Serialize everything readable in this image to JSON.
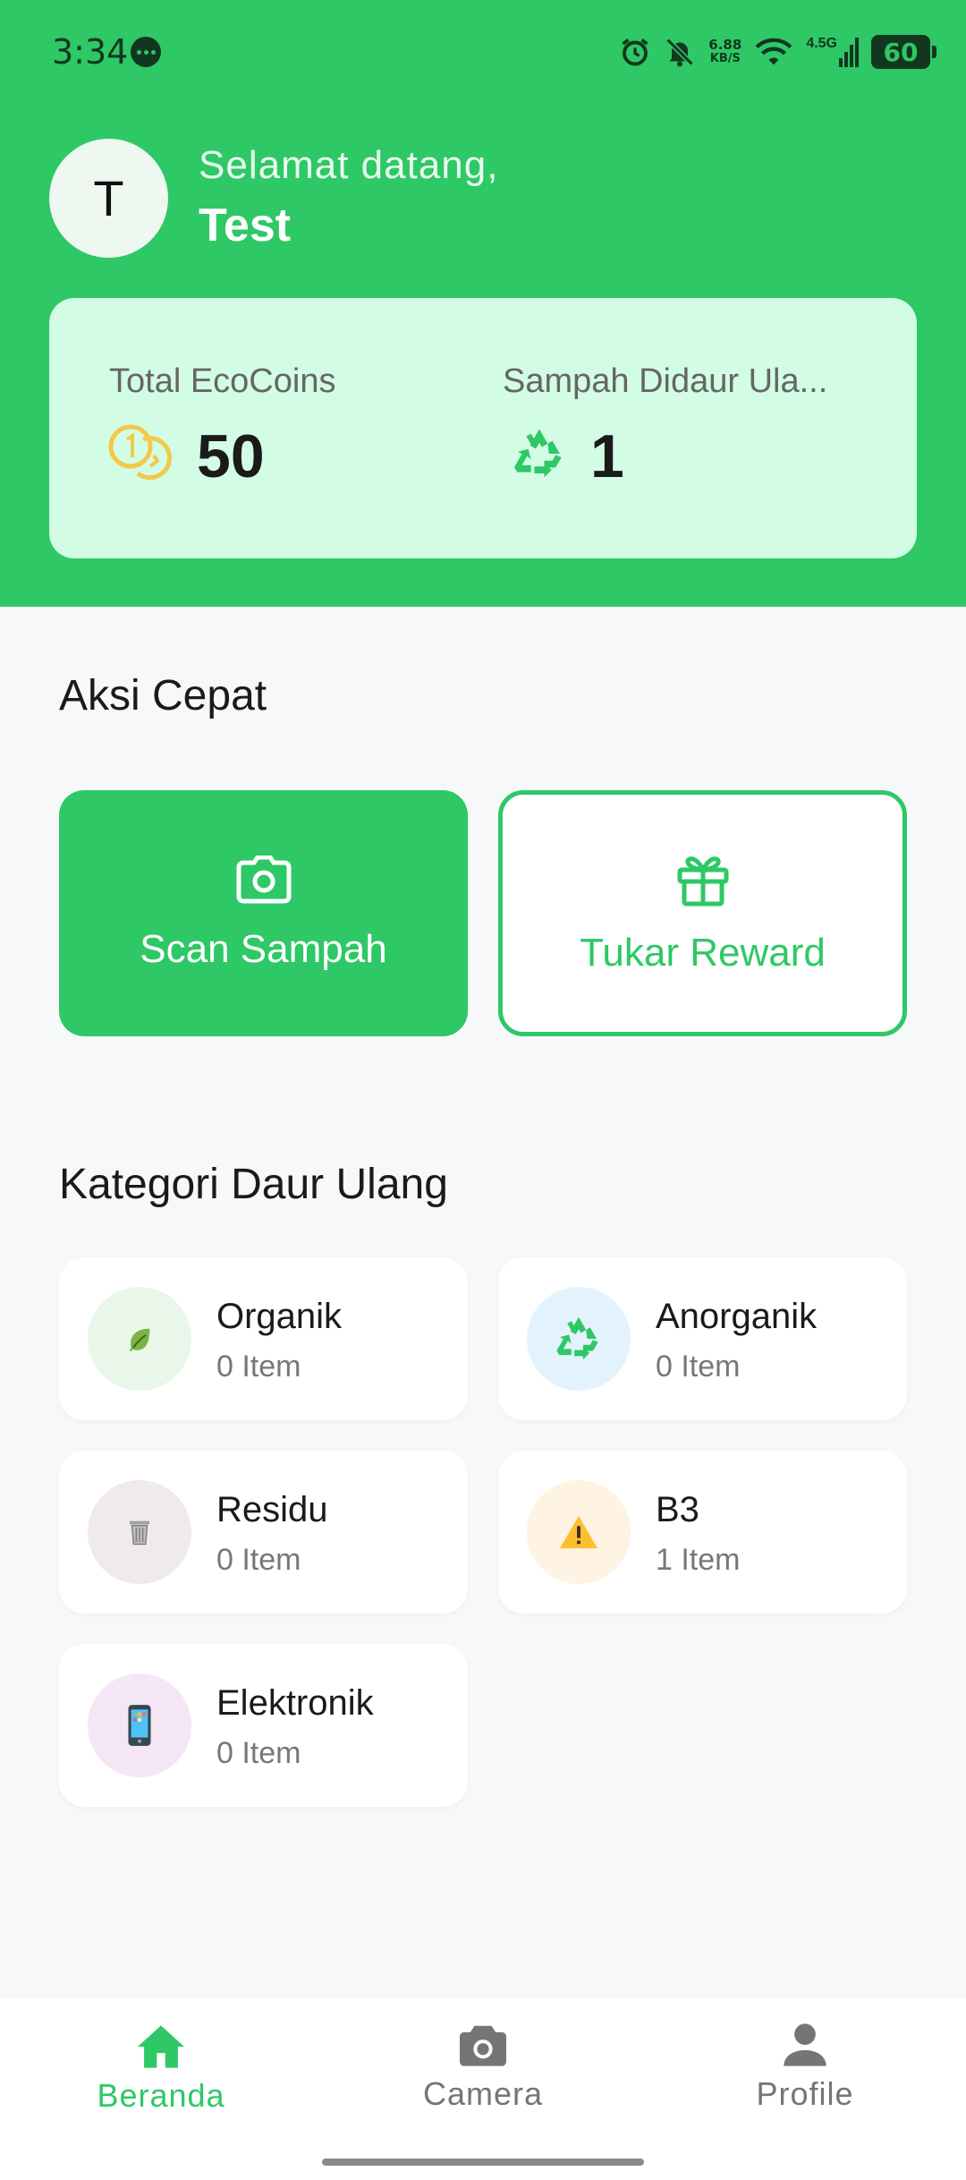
{
  "status_bar": {
    "time": "3:34",
    "speed_value": "6.88",
    "speed_unit": "KB/S",
    "network": "4.5G",
    "battery": "60"
  },
  "header": {
    "avatar_letter": "T",
    "greeting": "Selamat datang,",
    "username": "Test"
  },
  "stats": {
    "coins_label": "Total EcoCoins",
    "coins_value": "50",
    "recycled_label": "Sampah Didaur Ula...",
    "recycled_value": "1"
  },
  "quick_actions": {
    "title": "Aksi Cepat",
    "scan_label": "Scan Sampah",
    "reward_label": "Tukar Reward"
  },
  "categories": {
    "title": "Kategori Daur Ulang",
    "items": [
      {
        "name": "Organik",
        "count": "0 Item",
        "icon": "leaf-icon",
        "color": "#e9f6ea"
      },
      {
        "name": "Anorganik",
        "count": "0 Item",
        "icon": "recycle-icon",
        "color": "#e3f3fd"
      },
      {
        "name": "Residu",
        "count": "0 Item",
        "icon": "trash-icon",
        "color": "#f0ebea"
      },
      {
        "name": "B3",
        "count": "1 Item",
        "icon": "warning-icon",
        "color": "#fff3e3"
      },
      {
        "name": "Elektronik",
        "count": "0 Item",
        "icon": "phone-icon",
        "color": "#f5e6f5"
      }
    ]
  },
  "bottom_nav": {
    "items": [
      {
        "label": "Beranda",
        "icon": "home-icon",
        "active": true
      },
      {
        "label": "Camera",
        "icon": "camera-icon",
        "active": false
      },
      {
        "label": "Profile",
        "icon": "person-icon",
        "active": false
      }
    ]
  },
  "colors": {
    "primary": "#2ec866",
    "card_bg": "#d2fde4",
    "page_bg": "#f7f8fa",
    "inactive": "#757575"
  }
}
